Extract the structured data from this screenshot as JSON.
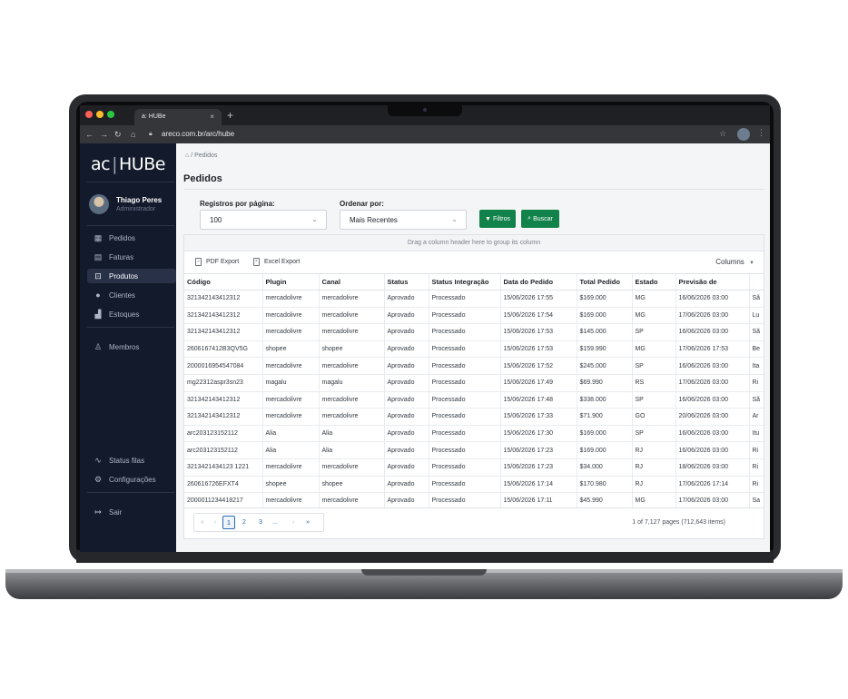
{
  "browser": {
    "tab_title": "HUBe",
    "tab_icon": "a:",
    "tab_close": "×",
    "new_tab": "+",
    "url": "areco.com.br/arc/hube",
    "traffic_colors": [
      "#ff5f57",
      "#febc2e",
      "#28c840"
    ]
  },
  "sidebar": {
    "logo_prefix": "ac",
    "logo_sep": "|",
    "logo_name": "HUBe",
    "user_name": "Thiago Peres",
    "user_role": "Administrador",
    "items": [
      {
        "label": "Pedidos",
        "icon": "grid-icon"
      },
      {
        "label": "Faturas",
        "icon": "invoice-icon"
      },
      {
        "label": "Produtos",
        "icon": "box-icon",
        "active": true
      },
      {
        "label": "Clientes",
        "icon": "user-icon"
      },
      {
        "label": "Estoques",
        "icon": "warehouse-icon"
      },
      {
        "label": "Membros",
        "icon": "members-icon"
      },
      {
        "label": "Status filas",
        "icon": "activity-icon"
      },
      {
        "label": "Configurações",
        "icon": "gear-icon"
      },
      {
        "label": "Sair",
        "icon": "logout-icon"
      }
    ]
  },
  "main": {
    "breadcrumb_sep": "/",
    "breadcrumb": "Pedidos",
    "title": "Pedidos",
    "per_page_label": "Registros por página:",
    "per_page_value": "100",
    "order_label": "Ordenar por:",
    "order_value": "Mais Recentes",
    "filters_label": "Filtros",
    "search_label": "Buscar",
    "accent": "#11824a"
  },
  "grid": {
    "group_hint": "Drag a column header here to group its column",
    "pdf_export": "PDF Export",
    "excel_export": "Excel Export",
    "columns_button": "Columns",
    "headers": [
      "Código",
      "Plugin",
      "Canal",
      "Status",
      "Status Integração",
      "Data do Pedido",
      "Total Pedido",
      "Estado",
      "Previsão de",
      ""
    ],
    "rows": [
      [
        "321342143412312",
        "mercadolivre",
        "mercadolivre",
        "Aprovado",
        "Processado",
        "15/06/2026 17:55",
        "$169.000",
        "MG",
        "16/06/2026 03:00",
        "Sã"
      ],
      [
        "321342143412312",
        "mercadolivre",
        "mercadolivre",
        "Aprovado",
        "Processado",
        "15/06/2026 17:54",
        "$169.000",
        "MG",
        "17/06/2026 03:00",
        "Lu"
      ],
      [
        "321342143412312",
        "mercadolivre",
        "mercadolivre",
        "Aprovado",
        "Processado",
        "15/06/2026 17:53",
        "$145.000",
        "SP",
        "16/06/2026 03:00",
        "Sã"
      ],
      [
        "2606167412B3QV5G",
        "shopee",
        "shopee",
        "Aprovado",
        "Processado",
        "15/06/2026 17:53",
        "$159.990",
        "MG",
        "17/06/2026 17:53",
        "Be"
      ],
      [
        "2000016954547084",
        "mercadolivre",
        "mercadolivre",
        "Aprovado",
        "Processado",
        "15/06/2026 17:52",
        "$245.000",
        "SP",
        "16/06/2026 03:00",
        "Ita"
      ],
      [
        "mg22312aspr3sn23",
        "magalu",
        "magalu",
        "Aprovado",
        "Processado",
        "15/06/2026 17:49",
        "$69.990",
        "RS",
        "17/06/2026 03:00",
        "Ri"
      ],
      [
        "321342143412312",
        "mercadolivre",
        "mercadolivre",
        "Aprovado",
        "Processado",
        "15/06/2026 17:48",
        "$338.000",
        "SP",
        "16/06/2026 03:00",
        "Sã"
      ],
      [
        "321342143412312",
        "mercadolivre",
        "mercadolivre",
        "Aprovado",
        "Processado",
        "15/06/2026 17:33",
        "$71.900",
        "GO",
        "20/06/2026 03:00",
        "Ar"
      ],
      [
        "arc203123152112",
        "Alia",
        "Alia",
        "Aprovado",
        "Processado",
        "15/06/2026 17:30",
        "$169.000",
        "SP",
        "16/06/2026 03:00",
        "Itu"
      ],
      [
        "arc203123152112",
        "Alia",
        "Alia",
        "Aprovado",
        "Processado",
        "15/06/2026 17:23",
        "$169.000",
        "RJ",
        "16/06/2026 03:00",
        "Ri"
      ],
      [
        "3213421434123 1221",
        "mercadolivre",
        "mercadolivre",
        "Aprovado",
        "Processado",
        "15/06/2026 17:23",
        "$34.000",
        "RJ",
        "18/06/2026 03:00",
        "Ri"
      ],
      [
        "260616726EFXT4",
        "shopee",
        "shopee",
        "Aprovado",
        "Processado",
        "15/06/2026 17:14",
        "$170.980",
        "RJ",
        "17/06/2026 17:14",
        "Ri"
      ],
      [
        "2000011234418217",
        "mercadolivre",
        "mercadolivre",
        "Aprovado",
        "Processado",
        "15/06/2026 17:11",
        "$45.990",
        "MG",
        "17/06/2026 03:00",
        "Sa"
      ]
    ],
    "pager": {
      "first": "«",
      "prev": "‹",
      "pages": [
        "1",
        "2",
        "3",
        "..."
      ],
      "current": "1",
      "next": "›",
      "last": "»",
      "info": "1 of 7,127 pages (712,643 items)"
    }
  }
}
